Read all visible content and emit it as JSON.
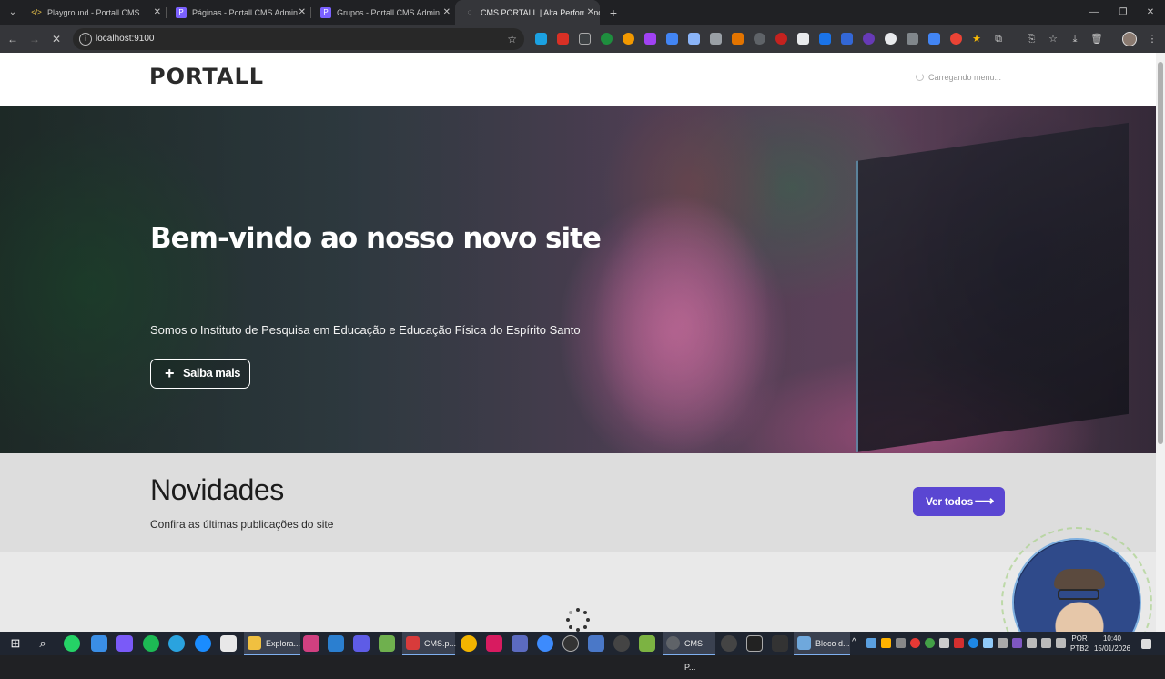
{
  "browser": {
    "tabs": [
      {
        "title": "Playground - Portall CMS",
        "favicon_color": "#f2c94c",
        "favicon": "</>"
      },
      {
        "title": "Páginas - Portall CMS Admin",
        "favicon_color": "#7b61ff",
        "favicon": "P"
      },
      {
        "title": "Grupos - Portall CMS Admin",
        "favicon_color": "#7b61ff",
        "favicon": "P"
      },
      {
        "title": "CMS PORTALL | Alta Performance",
        "favicon_color": "#9aa0a6",
        "favicon": "◌"
      }
    ],
    "new_tab_label": "+",
    "address": "localhost:9100",
    "window_controls": [
      "—",
      "❐",
      "✕"
    ]
  },
  "site": {
    "logo": "PORTALL",
    "menu_loading": "Carregando menu...",
    "hero": {
      "title": "Bem-vindo ao nosso novo site",
      "subtitle": "Somos o Instituto de Pesquisa em Educação e Educação Física do Espírito Santo",
      "button_label": "Saiba mais",
      "button_icon": "plus-icon"
    },
    "news": {
      "title": "Novidades",
      "subtitle": "Confira as últimas publicações do site",
      "button_label": "Ver todos",
      "button_icon": "arrow-right-icon",
      "button_color": "#5a46d2"
    }
  },
  "taskbar": {
    "apps": [
      {
        "label": "Explora...",
        "icon_color": "#f0c040"
      },
      {
        "label": "CMS.p...",
        "icon_color": "#d83b3b"
      },
      {
        "label": "CMS P...",
        "icon_color": "#5f6368"
      },
      {
        "label": "Bloco d...",
        "icon_color": "#6fa8dc"
      }
    ],
    "language": "POR",
    "keyboard": "PTB2",
    "time": "10:40",
    "date": "15/01/2026"
  }
}
